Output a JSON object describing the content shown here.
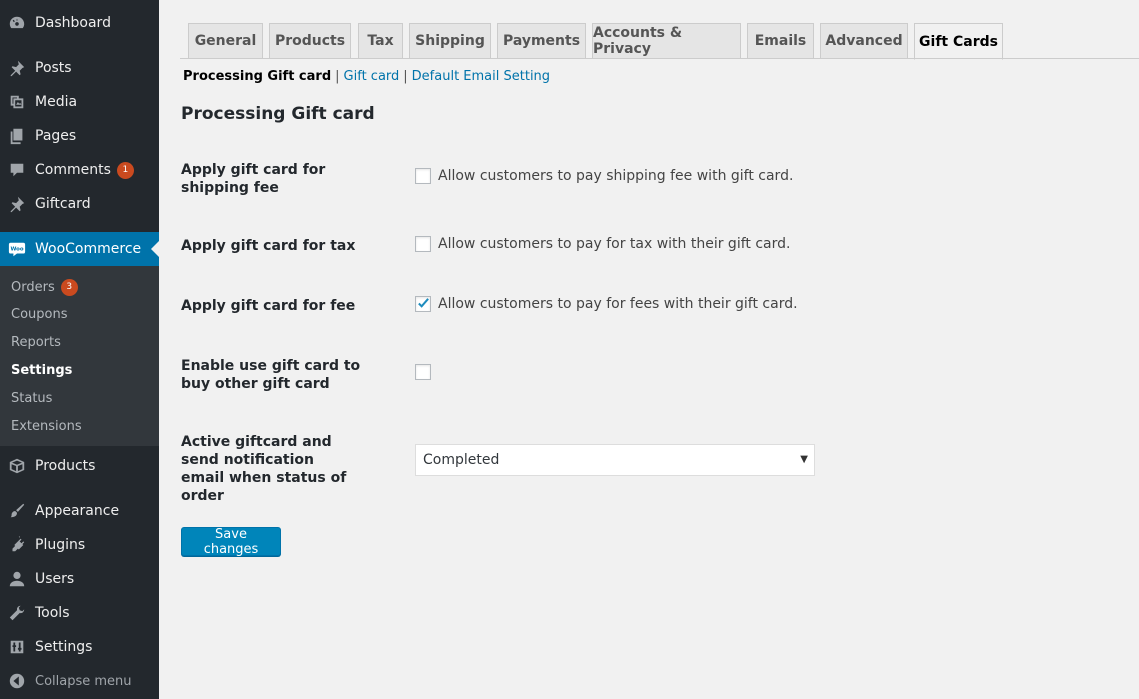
{
  "sidebar": {
    "dashboard": "Dashboard",
    "posts": "Posts",
    "media": "Media",
    "pages": "Pages",
    "comments": "Comments",
    "comments_badge": "1",
    "giftcard": "Giftcard",
    "woocommerce": "WooCommerce",
    "woo_logo_text": "Woo",
    "submenu": {
      "orders": "Orders",
      "orders_badge": "3",
      "coupons": "Coupons",
      "reports": "Reports",
      "settings": "Settings",
      "status": "Status",
      "extensions": "Extensions"
    },
    "products": "Products",
    "appearance": "Appearance",
    "plugins": "Plugins",
    "users": "Users",
    "tools": "Tools",
    "settings": "Settings",
    "collapse": "Collapse menu"
  },
  "tabs": {
    "general": "General",
    "products": "Products",
    "tax": "Tax",
    "shipping": "Shipping",
    "payments": "Payments",
    "accounts": "Accounts & Privacy",
    "emails": "Emails",
    "advanced": "Advanced",
    "gift_cards": "Gift Cards"
  },
  "subsections": {
    "processing": "Processing Gift card",
    "gift_card": "Gift card",
    "default_email": "Default Email Setting",
    "separator": "|"
  },
  "section_title": "Processing Gift card",
  "fields": {
    "shipping_fee": {
      "label": "Apply gift card for shipping fee",
      "description": "Allow customers to pay shipping fee with gift card.",
      "checked": false
    },
    "tax": {
      "label": "Apply gift card for tax",
      "description": "Allow customers to pay for tax with their gift card.",
      "checked": false
    },
    "fee": {
      "label": "Apply gift card for fee",
      "description": "Allow customers to pay for fees with their gift card.",
      "checked": true
    },
    "buy_gift_card": {
      "label": "Enable use gift card to buy other gift card",
      "checked": false
    },
    "order_status": {
      "label": "Active giftcard and send notification email when status of order",
      "value": "Completed"
    }
  },
  "save_button": "Save changes",
  "colors": {
    "sidebar_bg": "#23282d",
    "accent": "#0073aa",
    "button": "#0085ba",
    "badge": "#ca4a1f"
  }
}
